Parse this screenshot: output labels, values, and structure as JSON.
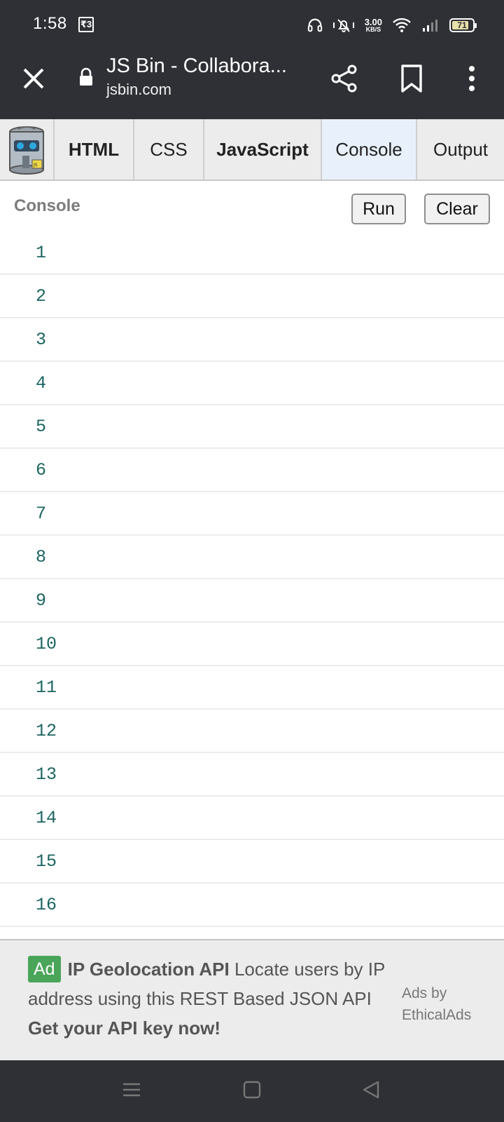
{
  "status_bar": {
    "time": "1:58",
    "rupee_glyph": "₹3",
    "net_speed_value": "3.00",
    "net_speed_unit": "KB/S",
    "battery_level": "71",
    "icons": [
      "headphones-icon",
      "mute-icon",
      "wifi-icon",
      "signal-icon",
      "battery-icon"
    ]
  },
  "browser": {
    "title": "JS Bin - Collabora...",
    "url": "jsbin.com",
    "icons": [
      "close-icon",
      "lock-icon",
      "share-icon",
      "bookmark-icon",
      "more-vert-icon"
    ]
  },
  "tabs": [
    {
      "label": "HTML",
      "bold": true,
      "active": false
    },
    {
      "label": "CSS",
      "bold": false,
      "active": false
    },
    {
      "label": "JavaScript",
      "bold": true,
      "active": false
    },
    {
      "label": "Console",
      "bold": false,
      "active": true
    },
    {
      "label": "Output",
      "bold": false,
      "active": false
    }
  ],
  "console": {
    "title": "Console",
    "run_label": "Run",
    "clear_label": "Clear",
    "lines": [
      "1",
      "2",
      "3",
      "4",
      "5",
      "6",
      "7",
      "8",
      "9",
      "10",
      "11",
      "12",
      "13",
      "14",
      "15",
      "16"
    ]
  },
  "ad": {
    "badge": "Ad",
    "headline": "IP Geolocation API",
    "body": " Locate users by IP address using this REST Based JSON API ",
    "cta": "Get your API key now!",
    "provider_line1": "Ads by",
    "provider_line2": "EthicalAds",
    "badge_color": "#4aa55a"
  },
  "colors": {
    "system_bar": "#2f3035",
    "console_text": "#1c6561",
    "active_tab": "#e8f1fb"
  }
}
